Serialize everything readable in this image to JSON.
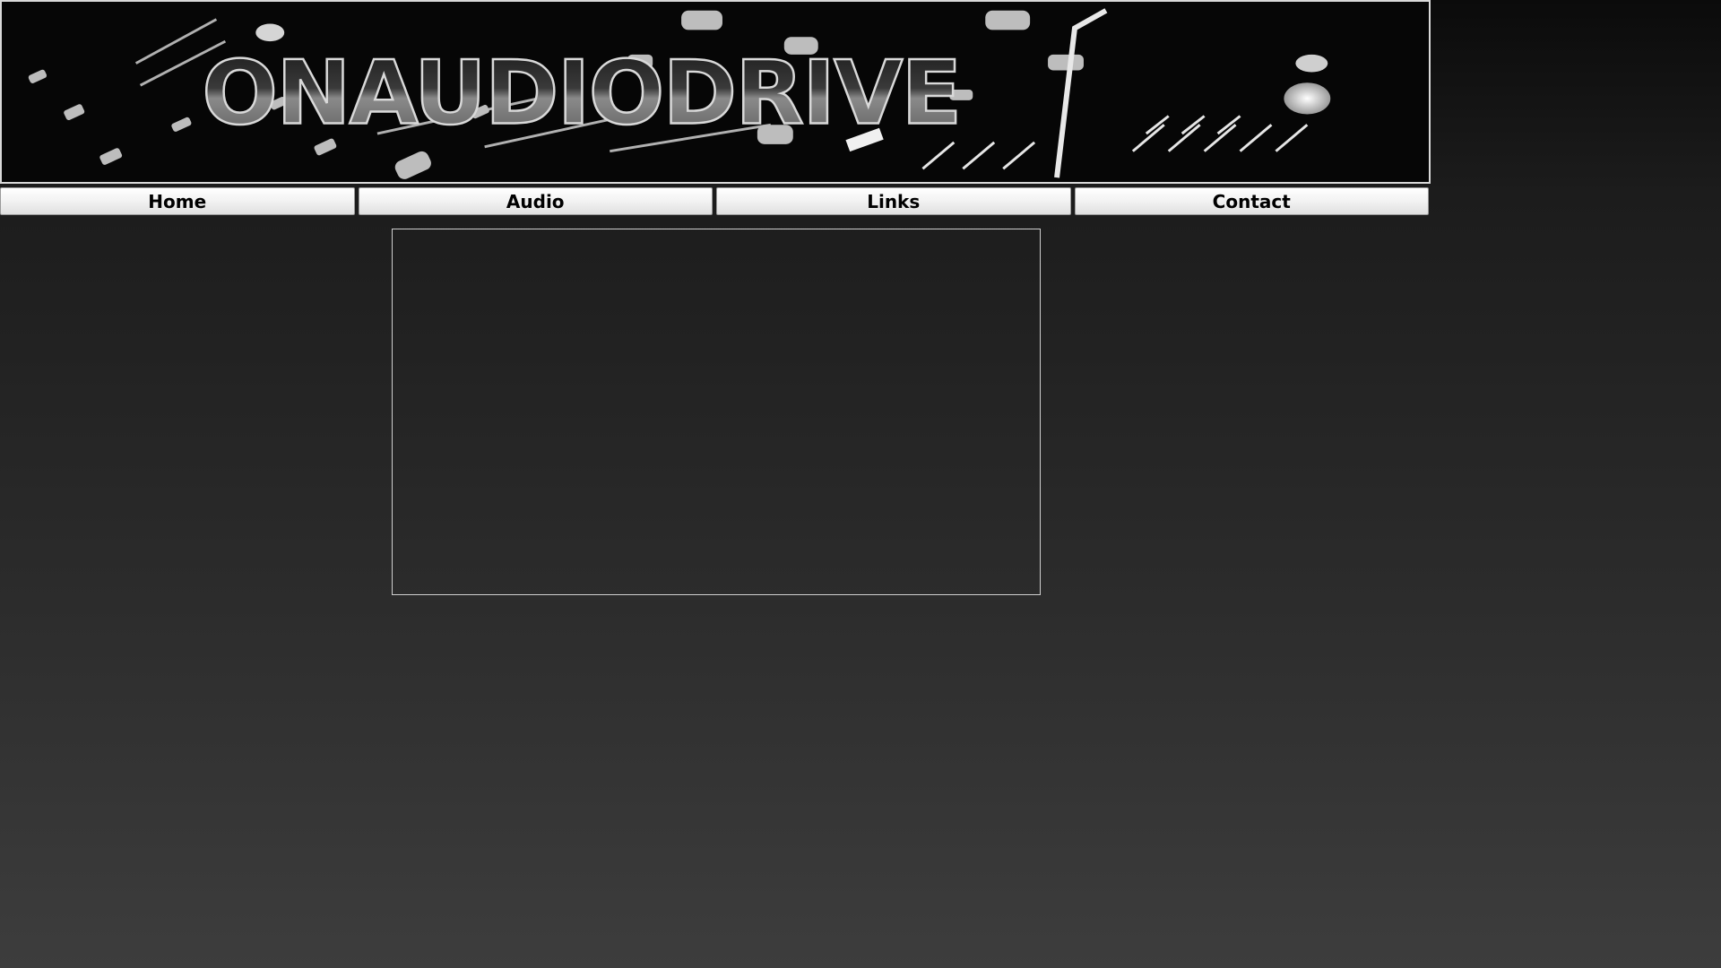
{
  "banner": {
    "logo_text": "ONAUDIODRIVE",
    "background_image": "audio-mixer-console"
  },
  "nav": {
    "items": [
      {
        "label": "Home"
      },
      {
        "label": "Audio"
      },
      {
        "label": "Links"
      },
      {
        "label": "Contact"
      }
    ]
  },
  "colors": {
    "page_gradient_top": "#0b0b0b",
    "page_gradient_bottom": "#3d3d3d",
    "nav_button": "#f2f2f2",
    "frame_border": "#cfcfcf"
  }
}
